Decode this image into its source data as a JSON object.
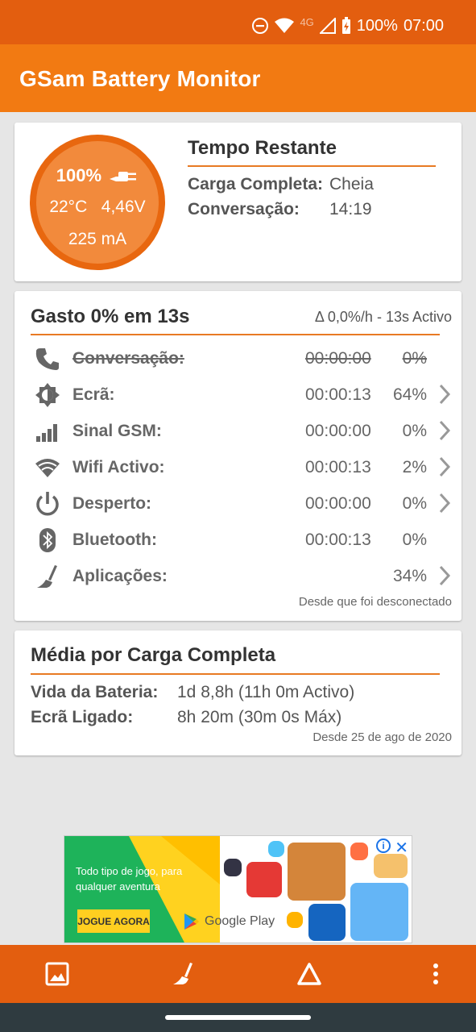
{
  "status_bar": {
    "network": "4G",
    "battery": "100%",
    "time": "07:00"
  },
  "app": {
    "title": "GSam Battery Monitor"
  },
  "gauge": {
    "level": "100%",
    "temperature": "22°C",
    "voltage": "4,46V",
    "current": "225 mA",
    "level_fraction": 1.0
  },
  "time_remaining": {
    "title": "Tempo Restante",
    "rows": [
      {
        "label": "Carga Completa:",
        "value": "Cheia"
      },
      {
        "label": "Conversação:",
        "value": "14:19"
      }
    ]
  },
  "usage": {
    "title": "Gasto 0% em 13s",
    "rate": "Δ 0,0%/h - 13s Activo",
    "rows": [
      {
        "icon": "phone-icon",
        "label": "Conversação:",
        "time": "00:00:00",
        "pct": "0%",
        "struck": true,
        "chevron": false
      },
      {
        "icon": "brightness-icon",
        "label": "Ecrã:",
        "time": "00:00:13",
        "pct": "64%",
        "struck": false,
        "chevron": true
      },
      {
        "icon": "signal-icon",
        "label": "Sinal GSM:",
        "time": "00:00:00",
        "pct": "0%",
        "struck": false,
        "chevron": true
      },
      {
        "icon": "wifi-icon",
        "label": "Wifi Activo:",
        "time": "00:00:13",
        "pct": "2%",
        "struck": false,
        "chevron": true
      },
      {
        "icon": "power-icon",
        "label": "Desperto:",
        "time": "00:00:00",
        "pct": "0%",
        "struck": false,
        "chevron": true
      },
      {
        "icon": "bluetooth-icon",
        "label": "Bluetooth:",
        "time": "00:00:13",
        "pct": "0%",
        "struck": false,
        "chevron": false
      },
      {
        "icon": "apps-broom-icon",
        "label": "Aplicações:",
        "time": "",
        "pct": "34%",
        "struck": false,
        "chevron": true
      }
    ],
    "footer": "Desde que foi desconectado"
  },
  "average": {
    "title": "Média por Carga Completa",
    "rows": [
      {
        "label": "Vida da Bateria:",
        "value": "1d 8,8h (11h 0m Activo)"
      },
      {
        "label": "Ecrã Ligado:",
        "value": "8h 20m (30m 0s Máx)"
      }
    ],
    "footer": "Desde 25 de ago de 2020"
  },
  "ad": {
    "text": "Todo tipo de jogo, para qualquer aventura",
    "button": "JOGUE AGORA",
    "store": "Google Play"
  },
  "colors": {
    "status_bar": "#e35e0f",
    "app_bar": "#f27a12",
    "accent_line": "#e87a23",
    "gauge_fill": "#f28a3c",
    "nav_bar": "#2f3b40"
  }
}
